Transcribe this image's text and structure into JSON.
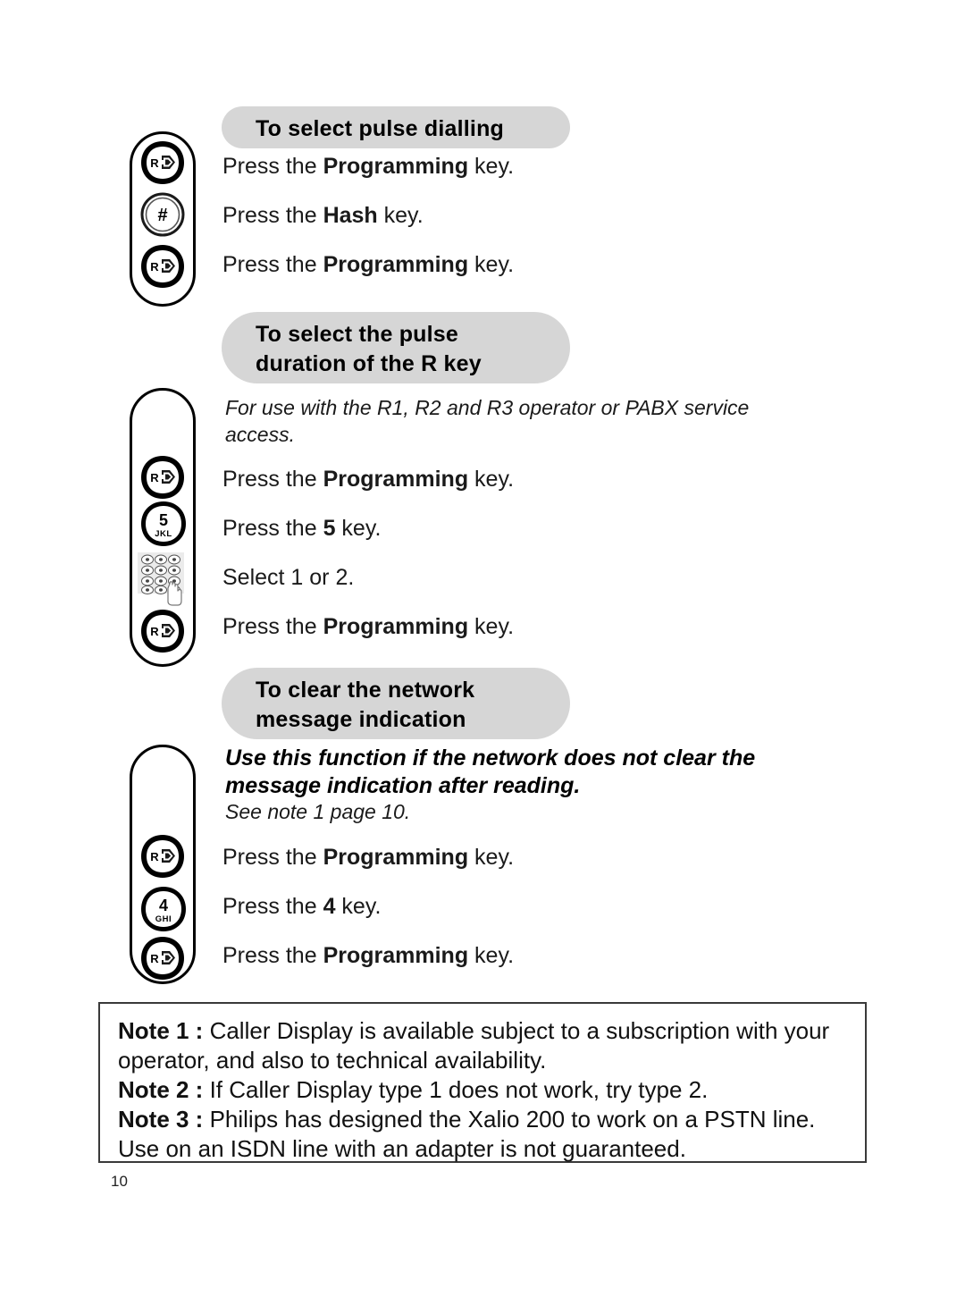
{
  "page": {
    "folio": "10"
  },
  "sections": [
    {
      "id": "pulse-dialling",
      "heading_lines": [
        "To select pulse dialling"
      ],
      "steps": [
        {
          "icon": "programming-r-key-icon",
          "pre": "Press the ",
          "bold": "Programming",
          "post": " key."
        },
        {
          "icon": "hash-key-icon",
          "pre": "Press the ",
          "bold": "Hash",
          "post": " key."
        },
        {
          "icon": "programming-r-key-icon",
          "pre": "Press the ",
          "bold": "Programming",
          "post": " key."
        }
      ]
    },
    {
      "id": "pulse-duration-r-key",
      "heading_lines": [
        "To select the pulse",
        "duration of the R key"
      ],
      "intro_italic": "For use with the R1, R2 and R3 operator or PABX service access.",
      "steps": [
        {
          "icon": "programming-r-key-icon",
          "pre": "Press the ",
          "bold": "Programming",
          "post": " key."
        },
        {
          "icon": "digit-5-jkl-key-icon",
          "pre": "Press the ",
          "bold": "5",
          "post": " key."
        },
        {
          "icon": "keypad-icon",
          "pre": "Select 1 or 2.",
          "bold": "",
          "post": ""
        },
        {
          "icon": "programming-r-key-icon",
          "pre": "Press the ",
          "bold": "Programming",
          "post": " key."
        }
      ]
    },
    {
      "id": "clear-network-message-indication",
      "heading_lines": [
        "To clear the network",
        "message indication"
      ],
      "intro_bold_italic_lines": [
        "Use this function if the network does not clear the",
        "message indication after reading."
      ],
      "intro_italic": "See note 1 page 10.",
      "steps": [
        {
          "icon": "programming-r-key-icon",
          "pre": "Press the ",
          "bold": "Programming",
          "post": " key."
        },
        {
          "icon": "digit-4-ghi-key-icon",
          "pre": "Press the ",
          "bold": "4",
          "post": " key."
        },
        {
          "icon": "programming-r-key-icon",
          "pre": "Press the ",
          "bold": "Programming",
          "post": " key."
        }
      ]
    }
  ],
  "notes": {
    "items": [
      {
        "label": "Note 1 :",
        "text": " Caller Display is available subject to a subscription with your operator, and also to technical availability."
      },
      {
        "label": "Note 2 :",
        "text": " If Caller Display type 1 does not work, try type 2."
      },
      {
        "label": "Note 3 :",
        "text": " Philips has designed the Xalio 200 to work on a PSTN line. Use on an ISDN line with an adapter is not guaranteed."
      }
    ]
  },
  "keys": {
    "programming_label": "R",
    "hash_label": "#",
    "five_digit": "5",
    "five_letters": "JKL",
    "four_digit": "4",
    "four_letters": "GHI"
  },
  "colors": {
    "pill_background": "#d6d6d6",
    "text": "#000000",
    "box_border": "#3a3a3a",
    "keypad_background": "#ebebeb"
  }
}
